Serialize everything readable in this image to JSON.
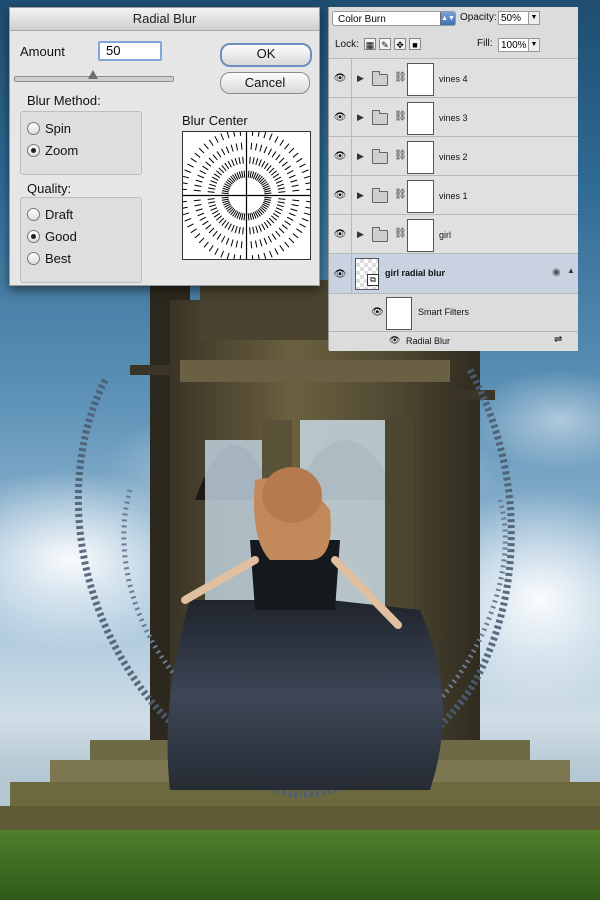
{
  "dialog": {
    "title": "Radial Blur",
    "amount_label": "Amount",
    "amount_value": "50",
    "amount_fraction": 0.5,
    "ok": "OK",
    "cancel": "Cancel",
    "blur_method_label": "Blur Method:",
    "methods": [
      {
        "label": "Spin",
        "selected": false
      },
      {
        "label": "Zoom",
        "selected": true
      }
    ],
    "quality_label": "Quality:",
    "qualities": [
      {
        "label": "Draft",
        "selected": false
      },
      {
        "label": "Good",
        "selected": true
      },
      {
        "label": "Best",
        "selected": false
      }
    ],
    "blur_center_label": "Blur Center"
  },
  "layers": {
    "blend_mode": "Color Burn",
    "opacity_label": "Opacity:",
    "opacity": "50%",
    "lock_label": "Lock:",
    "fill_label": "Fill:",
    "fill": "100%",
    "groups": [
      {
        "name": "vines 4"
      },
      {
        "name": "vines 3"
      },
      {
        "name": "vines 2"
      },
      {
        "name": "vines 1"
      },
      {
        "name": "girl"
      }
    ],
    "smart_layer": "girl radial blur",
    "smart_filters_label": "Smart Filters",
    "filter_name": "Radial Blur"
  },
  "colors": {
    "dialog_bg": "#e6e6e6",
    "panel_bg": "#e2e2e2",
    "selected_row": "#c8d2e0",
    "sky": "#2f6a93",
    "grass": "#3d6f25",
    "dress": "#2e3542"
  }
}
